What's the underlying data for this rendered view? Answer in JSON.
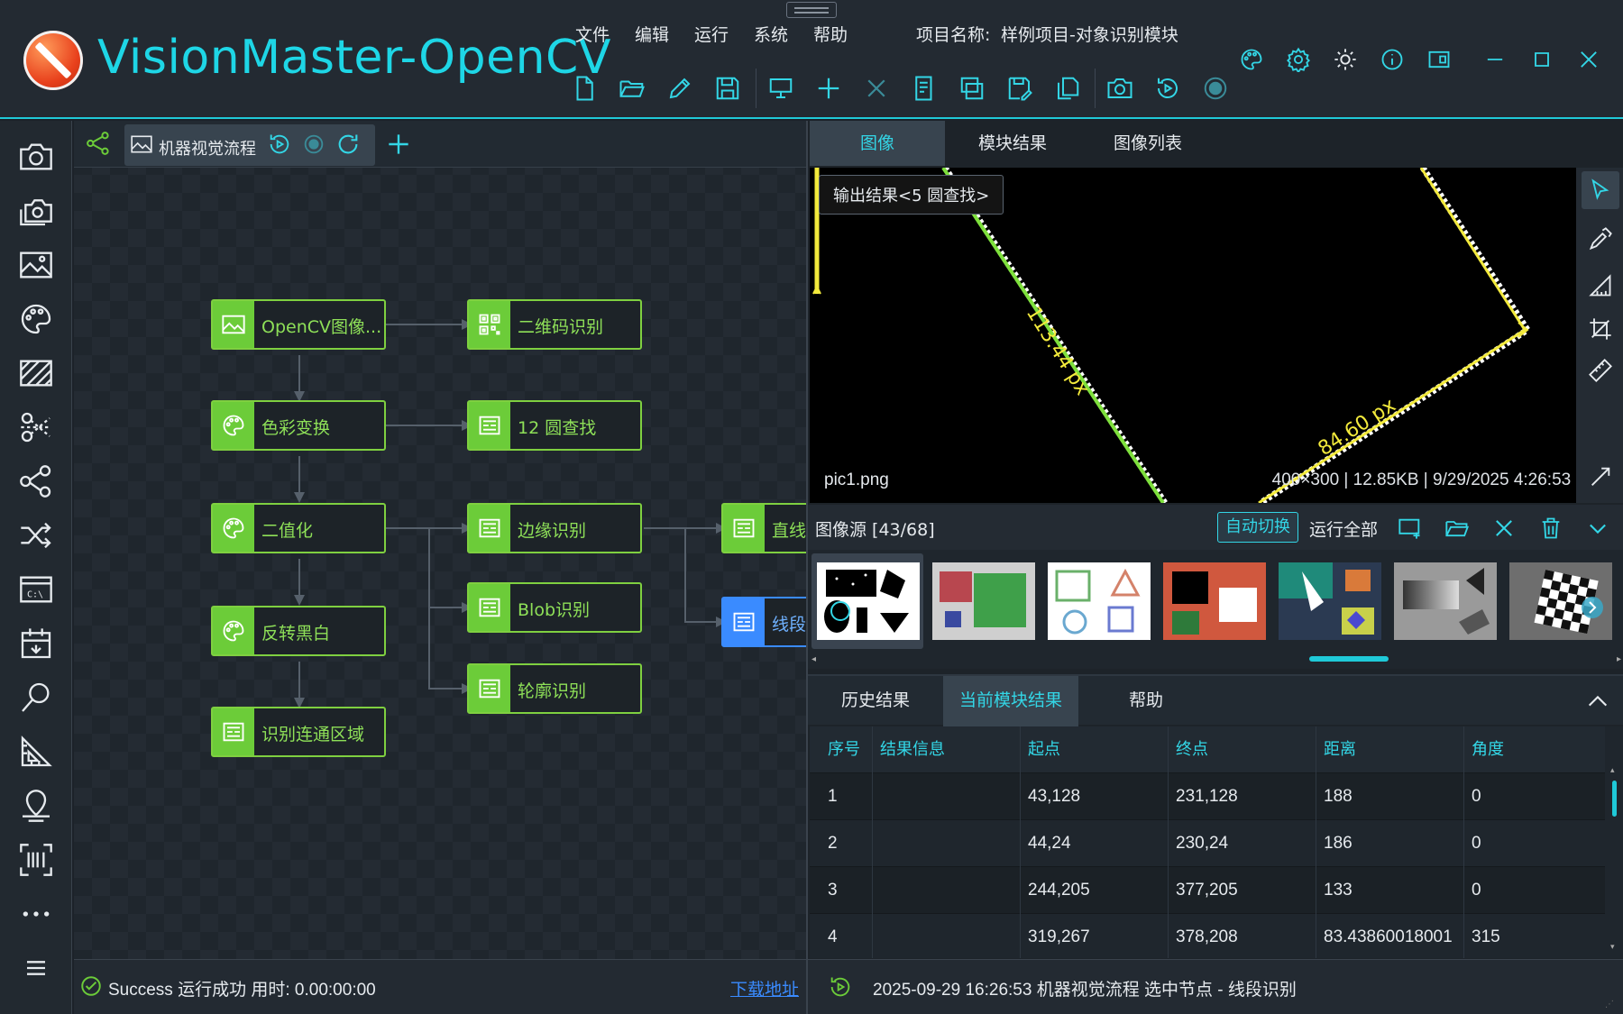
{
  "app": {
    "title": "VisionMaster-OpenCV"
  },
  "menu": [
    "文件",
    "编辑",
    "运行",
    "系统",
    "帮助"
  ],
  "project": {
    "label": "项目名称:",
    "name": "样例项目-对象识别模块"
  },
  "toolbar": [
    "new-file",
    "open-folder",
    "edit",
    "save",
    "monitor",
    "add",
    "delete",
    "document",
    "copy-image",
    "save-as",
    "duplicate",
    "camera",
    "replay",
    "record"
  ],
  "window_controls": [
    "palette",
    "settings",
    "theme",
    "info",
    "layout",
    "minimize",
    "maximize",
    "close"
  ],
  "sidebar": [
    "camera",
    "multi-camera",
    "image",
    "palette",
    "pattern",
    "cut",
    "graph",
    "shuffle",
    "terminal",
    "calendar",
    "search",
    "measure",
    "location",
    "scan",
    "more",
    "menu"
  ],
  "flow": {
    "tab_label": "机器视觉流程",
    "nodes": [
      {
        "label": "OpenCV图像...",
        "icon": "image"
      },
      {
        "label": "二维码识别",
        "icon": "qr"
      },
      {
        "label": "色彩变换",
        "icon": "palette"
      },
      {
        "label": "12 圆查找",
        "icon": "form"
      },
      {
        "label": "二值化",
        "icon": "palette"
      },
      {
        "label": "边缘识别",
        "icon": "form"
      },
      {
        "label": "直线",
        "icon": "form"
      },
      {
        "label": "Blob识别",
        "icon": "form"
      },
      {
        "label": "线段",
        "icon": "form"
      },
      {
        "label": "反转黑白",
        "icon": "palette"
      },
      {
        "label": "轮廓识别",
        "icon": "form"
      },
      {
        "label": "识别连通区域",
        "icon": "form"
      }
    ]
  },
  "status": {
    "text": "Success 运行成功 用时: 0.00:00:00",
    "link": "下载地址"
  },
  "viewer": {
    "tabs": [
      "图像",
      "模块结果",
      "图像列表"
    ],
    "tooltip": "输出结果<5 圆查找>",
    "measure_1": "113.44 px",
    "measure_2": "84.60 px",
    "image_name": "pic1.png",
    "image_meta": "400×300 | 12.85KB | 9/29/2025 4:26:53 PM",
    "tools": [
      "pointer",
      "eyedropper",
      "measure-area",
      "crop",
      "ruler",
      "expand"
    ]
  },
  "source": {
    "label": "图像源 [43/68]",
    "auto_switch": "自动切换",
    "run_all": "运行全部",
    "thumbnails": 7
  },
  "results": {
    "tabs": [
      "历史结果",
      "当前模块结果",
      "帮助"
    ],
    "columns": [
      "序号",
      "结果信息",
      "起点",
      "终点",
      "距离",
      "角度"
    ],
    "rows": [
      [
        "1",
        "",
        "43,128",
        "231,128",
        "188",
        "0"
      ],
      [
        "2",
        "",
        "44,24",
        "230,24",
        "186",
        "0"
      ],
      [
        "3",
        "",
        "244,205",
        "377,205",
        "133",
        "0"
      ],
      [
        "4",
        "",
        "319,267",
        "378,208",
        "83.43860018001",
        "315"
      ]
    ]
  },
  "log": {
    "text": "2025-09-29 16:26:53  机器视觉流程 选中节点 - 线段识别"
  },
  "colors": {
    "accent": "#1fc9d8",
    "node": "#6ccc39",
    "selected": "#3a8bff"
  }
}
